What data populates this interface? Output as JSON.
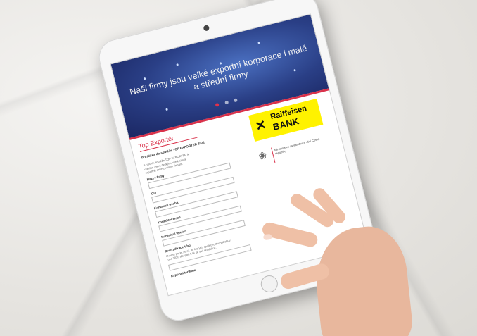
{
  "hero": {
    "title": "Naši firmy jsou velké exportní korporace i malé a střední firmy"
  },
  "section_title": "Top Exportér",
  "form": {
    "heading": "Přihláška do soutěže TOP EXPORTER 2021",
    "intro": "S. ročník soutěže TOP EXPORTER je otevřen všem českým, výrobním a exportně orientovaným firmám.",
    "fields": [
      {
        "label": "Název firmy"
      },
      {
        "label": "IČO"
      },
      {
        "label": "Kontaktní osoba"
      },
      {
        "label": "Kontaktní email"
      },
      {
        "label": "Kontaktní telefon"
      },
      {
        "label": "Diverzifikace trhů"
      }
    ],
    "note": "Uveďte počet zemí, do kterých společnost vyvážela v roce 2020 alespoň 5 % ze své produkce.",
    "last_field_label": "Exportní teritoria"
  },
  "sponsors": {
    "raiffeisen_name": "Raiffeisen",
    "raiffeisen_bank": "BANK",
    "ministry_text": "Ministerstvo zahraničních věcí České republiky"
  },
  "colors": {
    "accent": "#d9324b",
    "brand_yellow": "#fff200",
    "hero_blue": "#2a3f86"
  },
  "icons": {
    "raiffeisen_logo": "crossed-horse-heads-icon",
    "ministry_emblem": "state-emblem-icon"
  }
}
